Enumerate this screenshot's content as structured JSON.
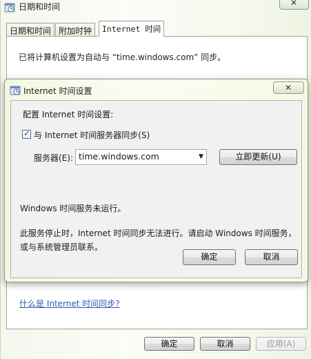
{
  "parent_window": {
    "title": "日期和时间",
    "close_glyph": "✕",
    "tabs": [
      {
        "label": "日期和时间"
      },
      {
        "label": "附加时钟"
      },
      {
        "label": "Internet 时间"
      }
    ],
    "synced_text": "已将计算机设置为自动与 “time.windows.com” 同步。",
    "help_link": "什么是 Internet 时间同步?",
    "buttons": {
      "ok": "确定",
      "cancel": "取消",
      "apply": "应用(A)"
    }
  },
  "dialog": {
    "title": "Internet 时间设置",
    "close_glyph": "✕",
    "config_label": "配置 Internet 时间设置:",
    "sync_checkbox": {
      "label": "与 Internet 时间服务器同步(S)",
      "checked": true
    },
    "server_label": "服务器(E):",
    "server_value": "time.windows.com",
    "update_button": "立即更新(U)",
    "status_text": "Windows 时间服务未运行。",
    "notice_text": "此服务停止时，Internet 时间同步无法进行。请启动 Windows 时间服务，或与系统管理员联系。",
    "buttons": {
      "ok": "确定",
      "cancel": "取消"
    }
  },
  "icons": {
    "clock": "clock-icon",
    "checkmark": "checkmark-icon",
    "dropdown": "chevron-down-icon"
  }
}
